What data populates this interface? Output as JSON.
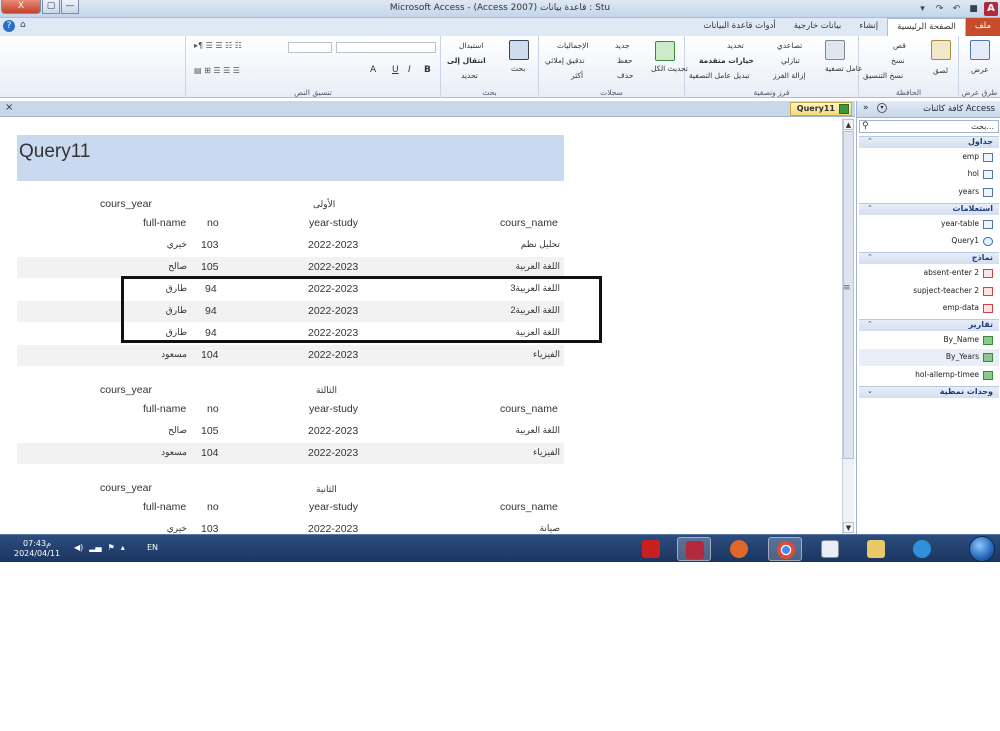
{
  "window": {
    "title": "Microsoft Access - (Access 2007) قاعدة بيانات : Stu",
    "close_label": "X",
    "restore_label": "▢",
    "min_label": "—",
    "app_logo": "A"
  },
  "tabs": [
    {
      "label": "ملف"
    },
    {
      "label": "الصفحة الرئيسية"
    },
    {
      "label": "إنشاء"
    },
    {
      "label": "بيانات خارجية"
    },
    {
      "label": "أدوات قاعدة البيانات"
    }
  ],
  "ribbon": {
    "groups": {
      "views": {
        "label": "طرق عرض",
        "view_button": "عرض"
      },
      "clipboard": {
        "label": "الحافظة",
        "paste": "لصق",
        "cut": "قص",
        "copy": "نسخ",
        "format_painter": "نسخ التنسيق"
      },
      "sort_filter": {
        "label": "فرز وتصفية",
        "filter": "عامل تصفية",
        "ascending": "تصاعدي",
        "descending": "تنازلي",
        "remove_sort": "إزالة الفرز",
        "selection": "تحديد",
        "advanced": "خيارات متقدمة",
        "toggle_filter": "تبديل عامل التصفية"
      },
      "records": {
        "label": "سجلات",
        "refresh_all": "تحديث الكل",
        "new": "جديد",
        "save": "حفظ",
        "delete": "حذف",
        "totals": "الإجماليات",
        "spelling": "تدقيق إملائي",
        "more": "أكثر"
      },
      "find": {
        "label": "بحث",
        "find": "بحث",
        "replace": "استبدال",
        "goto": "انتقال إلى",
        "select": "تحديد"
      },
      "text_formatting": {
        "label": "تنسيق النص",
        "bold": "B",
        "italic": "I",
        "underline": "U",
        "font_color": "A"
      }
    }
  },
  "document_tab": {
    "label": "Query11",
    "close": "×"
  },
  "report": {
    "title": "Query11",
    "groups": [
      {
        "group_value": "الأولى",
        "group_field": "cours_year",
        "columns": {
          "cours_name": "cours_name",
          "year_study": "year-study",
          "no": "no",
          "full_name": "full-name"
        },
        "rows": [
          {
            "cours_name": "تحليل نظم",
            "year_study": "2022-2023",
            "no": "103",
            "full_name": "خيري"
          },
          {
            "cours_name": "اللغة العربية",
            "year_study": "2022-2023",
            "no": "105",
            "full_name": "صالح"
          },
          {
            "cours_name": "اللغة العربية3",
            "year_study": "2022-2023",
            "no": "94",
            "full_name": "طارق"
          },
          {
            "cours_name": "اللغة العربية2",
            "year_study": "2022-2023",
            "no": "94",
            "full_name": "طارق"
          },
          {
            "cours_name": "اللغة العربية",
            "year_study": "2022-2023",
            "no": "94",
            "full_name": "طارق"
          },
          {
            "cours_name": "الفيزياء",
            "year_study": "2022-2023",
            "no": "104",
            "full_name": "مسعود"
          }
        ]
      },
      {
        "group_value": "الثالثة",
        "group_field": "cours_year",
        "columns": {
          "cours_name": "cours_name",
          "year_study": "year-study",
          "no": "no",
          "full_name": "full-name"
        },
        "rows": [
          {
            "cours_name": "اللغة العربية",
            "year_study": "2022-2023",
            "no": "105",
            "full_name": "صالح"
          },
          {
            "cours_name": "الفيزياء",
            "year_study": "2022-2023",
            "no": "104",
            "full_name": "مسعود"
          }
        ]
      },
      {
        "group_value": "الثانية",
        "group_field": "cours_year",
        "columns": {
          "cours_name": "cours_name",
          "year_study": "year-study",
          "no": "no",
          "full_name": "full-name"
        },
        "rows": [
          {
            "cours_name": "صيانة",
            "year_study": "2022-2023",
            "no": "103",
            "full_name": "خيري"
          }
        ]
      }
    ]
  },
  "nav_pane": {
    "title": "كافة كائنات Access",
    "search_placeholder": "بحث...",
    "sections": [
      {
        "label": "جداول",
        "items": [
          {
            "label": "emp",
            "type": "table"
          },
          {
            "label": "hol",
            "type": "table"
          },
          {
            "label": "years",
            "type": "table"
          }
        ]
      },
      {
        "label": "استعلامات",
        "items": [
          {
            "label": "year-table",
            "type": "query"
          },
          {
            "label": "Query1",
            "type": "query"
          }
        ]
      },
      {
        "label": "نماذج",
        "items": [
          {
            "label": "absent-enter 2",
            "type": "form"
          },
          {
            "label": "supject-teacher 2",
            "type": "form"
          },
          {
            "label": "emp-data",
            "type": "form"
          }
        ]
      },
      {
        "label": "تقارير",
        "items": [
          {
            "label": "By_Name",
            "type": "report"
          },
          {
            "label": "By_Years",
            "type": "report"
          },
          {
            "label": "hol-allemp-timee",
            "type": "report"
          }
        ]
      },
      {
        "label": "وحدات نمطية",
        "items": []
      }
    ]
  },
  "taskbar": {
    "time": "07:43م",
    "date": "2024/04/11",
    "lang": "EN",
    "apps": [
      "acrobat-icon",
      "access-icon",
      "media-icon",
      "chrome-icon",
      "player-icon",
      "explorer-icon",
      "ie-icon"
    ]
  },
  "colors": {
    "report_header_bg": "#c9daf0",
    "file_tab": "#c74d2a",
    "taskbar": "#1b3560"
  }
}
